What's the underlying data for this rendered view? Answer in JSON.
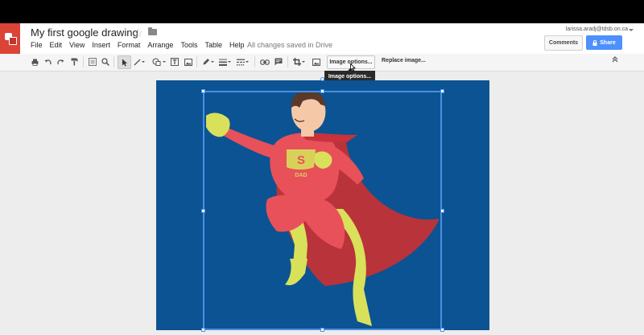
{
  "app": {
    "doc_title": "My first google drawing",
    "save_status": "All changes saved in Drive",
    "account_email": "larissa.aradj@tdsb.on.ca",
    "brand_color": "#db4437",
    "accent_color": "#4d90fe"
  },
  "menubar": {
    "items": [
      "File",
      "Edit",
      "View",
      "Insert",
      "Format",
      "Arrange",
      "Tools",
      "Table",
      "Help"
    ]
  },
  "header_buttons": {
    "comments": "Comments",
    "share": "Share"
  },
  "toolbar": {
    "icons": [
      "print-icon",
      "undo-icon",
      "redo-icon",
      "paint-format-icon",
      "zoom-fit-icon",
      "zoom-icon",
      "select-icon",
      "line-icon",
      "shape-icon",
      "text-box-icon",
      "image-icon",
      "border-color-icon",
      "border-weight-icon",
      "border-dash-icon",
      "link-icon",
      "comment-icon",
      "crop-icon",
      "replace-image-icon",
      "collapse-icon"
    ],
    "image_options_label": "Image options...",
    "replace_image_label": "Replace image...",
    "tooltip": "Image options..."
  },
  "canvas": {
    "background": "#0b5393",
    "image_description_icon": "superhero-illustration",
    "emblem_letter": "S",
    "emblem_text": "DAD"
  }
}
